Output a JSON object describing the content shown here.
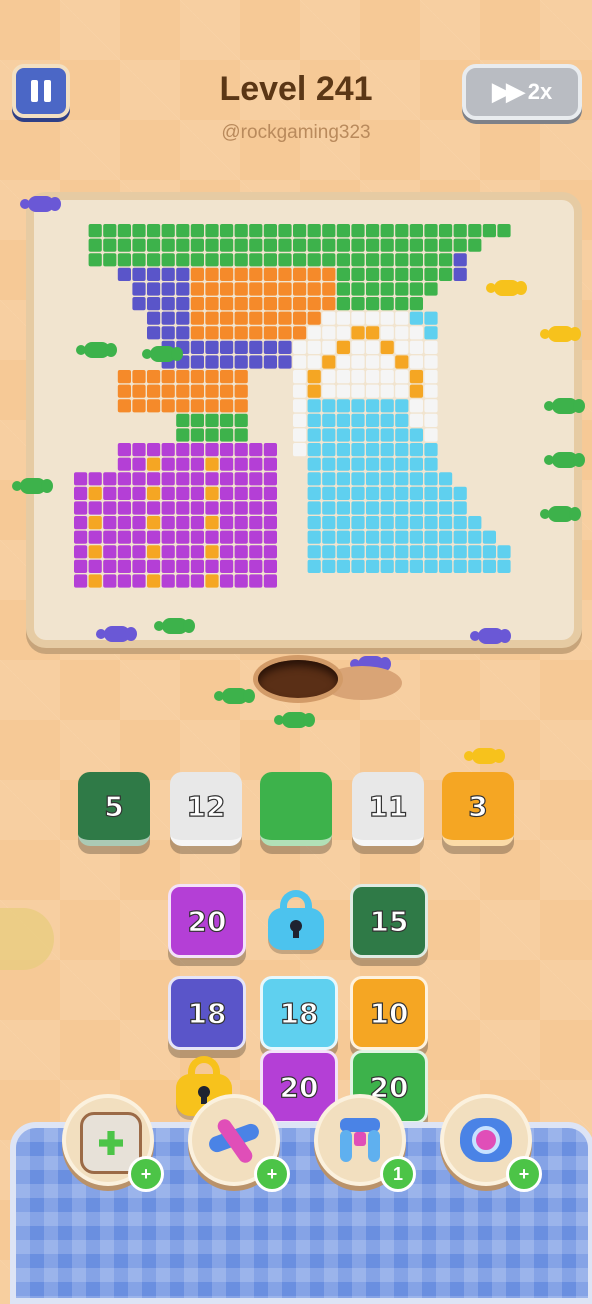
{
  "header": {
    "title": "Level 241",
    "subtitle": "@rockgaming323",
    "speed_label": "2x"
  },
  "colors": {
    "dark_green": "#2f7a47",
    "white": "#e8e8e8",
    "green": "#3db24b",
    "orange": "#f5a623",
    "purple": "#b43fd6",
    "indigo": "#5a55c9",
    "sky": "#5fd0ef",
    "lock_blue": "#4cc3ee",
    "lock_gold": "#f7c21c"
  },
  "queue_slots": [
    {
      "label": "5",
      "color": "dark_green"
    },
    {
      "label": "12",
      "color": "white"
    },
    {
      "label": "",
      "color": "green"
    },
    {
      "label": "11",
      "color": "white"
    },
    {
      "label": "3",
      "color": "orange"
    }
  ],
  "stack_grid": [
    {
      "label": "20",
      "color": "purple"
    },
    {
      "label": "",
      "color": "lock_blue",
      "locked": true
    },
    {
      "label": "15",
      "color": "dark_green"
    },
    {
      "label": "18",
      "color": "indigo"
    },
    {
      "label": "18",
      "color": "sky"
    },
    {
      "label": "10",
      "color": "orange"
    },
    {
      "label": "",
      "color": "lock_gold",
      "locked": true
    },
    {
      "label": "20",
      "color": "purple"
    },
    {
      "label": "20",
      "color": "green"
    }
  ],
  "boosters": [
    {
      "name": "add-slot",
      "badge": "+"
    },
    {
      "name": "shuffle",
      "badge": "+"
    },
    {
      "name": "magnet",
      "badge": "1"
    },
    {
      "name": "vacuum",
      "badge": "+"
    }
  ]
}
